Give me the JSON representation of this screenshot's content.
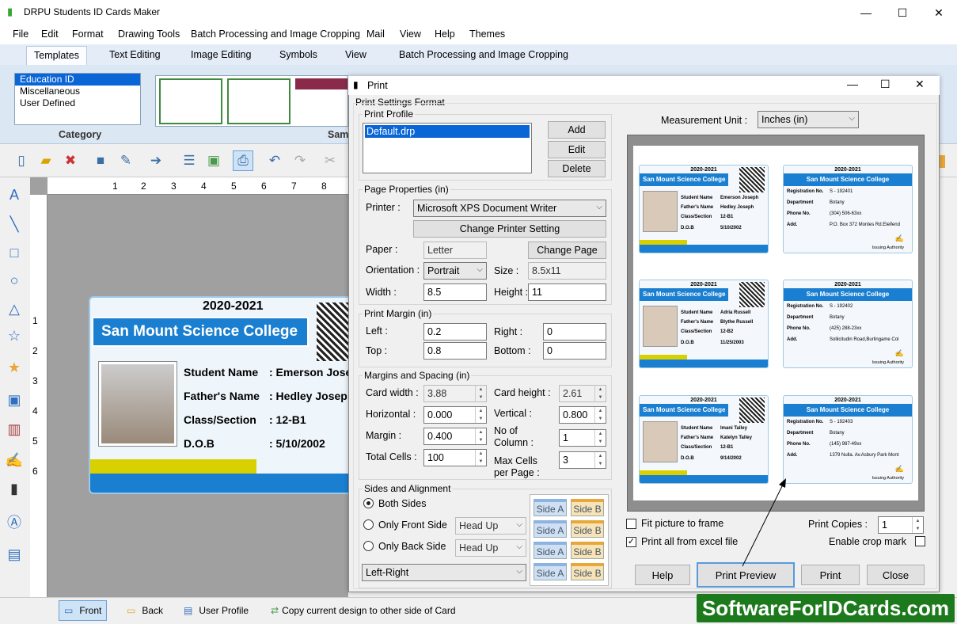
{
  "app": {
    "title": "DRPU Students ID Cards Maker"
  },
  "menu": [
    "File",
    "Edit",
    "Format",
    "Drawing Tools",
    "Batch Processing and Image Cropping",
    "Mail",
    "View",
    "Help",
    "Themes"
  ],
  "ribbon_tabs": [
    "Templates",
    "Text Editing",
    "Image Editing",
    "Symbols",
    "View",
    "Batch Processing and Image Cropping"
  ],
  "category": {
    "items": [
      "Education ID",
      "Miscellaneous",
      "User Defined"
    ],
    "label": "Category",
    "samples_label": "Sam"
  },
  "ruler": {
    "h": [
      "1",
      "2",
      "3",
      "4",
      "5",
      "6",
      "7",
      "8"
    ],
    "v": [
      "1",
      "2",
      "3",
      "4",
      "5",
      "6"
    ]
  },
  "card": {
    "year": "2020-2021",
    "college": "San Mount Science College",
    "fields": [
      {
        "label": "Student Name",
        "value": ": Emerson Jose"
      },
      {
        "label": "Father's Name",
        "value": ": Hedley Josep"
      },
      {
        "label": "Class/Section",
        "value": ": 12-B1"
      },
      {
        "label": "D.O.B",
        "value": ": 5/10/2002"
      }
    ]
  },
  "statusbar": {
    "front": "Front",
    "back": "Back",
    "user_profile": "User Profile",
    "copy": "Copy current design to other side of Card"
  },
  "dialog": {
    "title": "Print",
    "format_label": "Print Settings Format",
    "profile": {
      "label": "Print Profile",
      "selected": "Default.drp",
      "add": "Add",
      "edit": "Edit",
      "delete": "Delete"
    },
    "page_props": {
      "label": "Page Properties  (in)",
      "printer_label": "Printer :",
      "printer": "Microsoft XPS Document Writer",
      "change_printer": "Change Printer Setting",
      "paper_label": "Paper :",
      "paper": "Letter",
      "change_page": "Change Page",
      "orientation_label": "Orientation :",
      "orientation": "Portrait",
      "size_label": "Size :",
      "size": "8.5x11",
      "width_label": "Width :",
      "width": "8.5",
      "height_label": "Height :",
      "height": "11"
    },
    "margin": {
      "label": "Print Margin (in)",
      "left_label": "Left :",
      "left": "0.2",
      "right_label": "Right :",
      "right": "0",
      "top_label": "Top :",
      "top": "0.8",
      "bottom_label": "Bottom :",
      "bottom": "0"
    },
    "spacing": {
      "label": "Margins and Spacing  (in)",
      "card_width_label": "Card width :",
      "card_width": "3.88",
      "card_height_label": "Card height :",
      "card_height": "2.61",
      "horizontal_label": "Horizontal :",
      "horizontal": "0.000",
      "vertical_label": "Vertical :",
      "vertical": "0.800",
      "margin_label": "Margin :",
      "margin": "0.400",
      "columns_label1": "No of",
      "columns_label2": "Column :",
      "columns": "1",
      "total_label": "Total Cells :",
      "total": "100",
      "max_label1": "Max Cells",
      "max_label2": "per Page :",
      "max": "3"
    },
    "sides": {
      "label": "Sides and Alignment",
      "both": "Both Sides",
      "front": "Only Front Side",
      "back": "Only Back Side",
      "head_up": "Head Up",
      "align": "Left-Right",
      "side_a": "Side A",
      "side_b": "Side B"
    },
    "measure_label": "Measurement Unit :",
    "measure": "Inches (in)",
    "fit": "Fit picture to frame",
    "all_excel": "Print all from excel file",
    "copies_label": "Print Copies :",
    "copies": "1",
    "crop": "Enable crop mark",
    "buttons": {
      "help": "Help",
      "preview": "Print Preview",
      "print": "Print",
      "close": "Close"
    }
  },
  "preview_cards": [
    {
      "year": "2020-2021",
      "college": "San Mount Science College",
      "student": "Emerson Joseph",
      "father": "Hedley Joseph",
      "cls": "12-B1",
      "dob": "5/10/2002",
      "reg": "S - 192401",
      "dept": "Botany",
      "phone": "(304) 506-63xx",
      "addr": "P.O. Box 372 Montes Rd.Eleifend"
    },
    {
      "year": "2020-2021",
      "college": "San Mount Science College",
      "student": "Adria Russell",
      "father": "Blythe Russell",
      "cls": "12-B2",
      "dob": "11/25/2003",
      "reg": "S - 192402",
      "dept": "Botany",
      "phone": "(425) 288-23xx",
      "addr": "Sollicitudin Road,Burlingame Col"
    },
    {
      "year": "2020-2021",
      "college": "San Mount Science College",
      "student": "Imani Talley",
      "father": "Katelyn Talley",
      "cls": "12-B1",
      "dob": "9/14/2002",
      "reg": "S - 192403",
      "dept": "Botany",
      "phone": "(145) 987-49xx",
      "addr": "1379 Nulla. Av.Asbury Park Mont"
    }
  ],
  "preview_labels": {
    "student": "Student Name",
    "father": "Father's Name",
    "cls": "Class/Section",
    "dob": "D.O.B",
    "reg": "Registration No.",
    "dept": "Department",
    "phone": "Phone No.",
    "addr": "Add.",
    "sep": ":",
    "authority": "Issuing Authority"
  },
  "watermark": "SoftwareForIDCards.com"
}
